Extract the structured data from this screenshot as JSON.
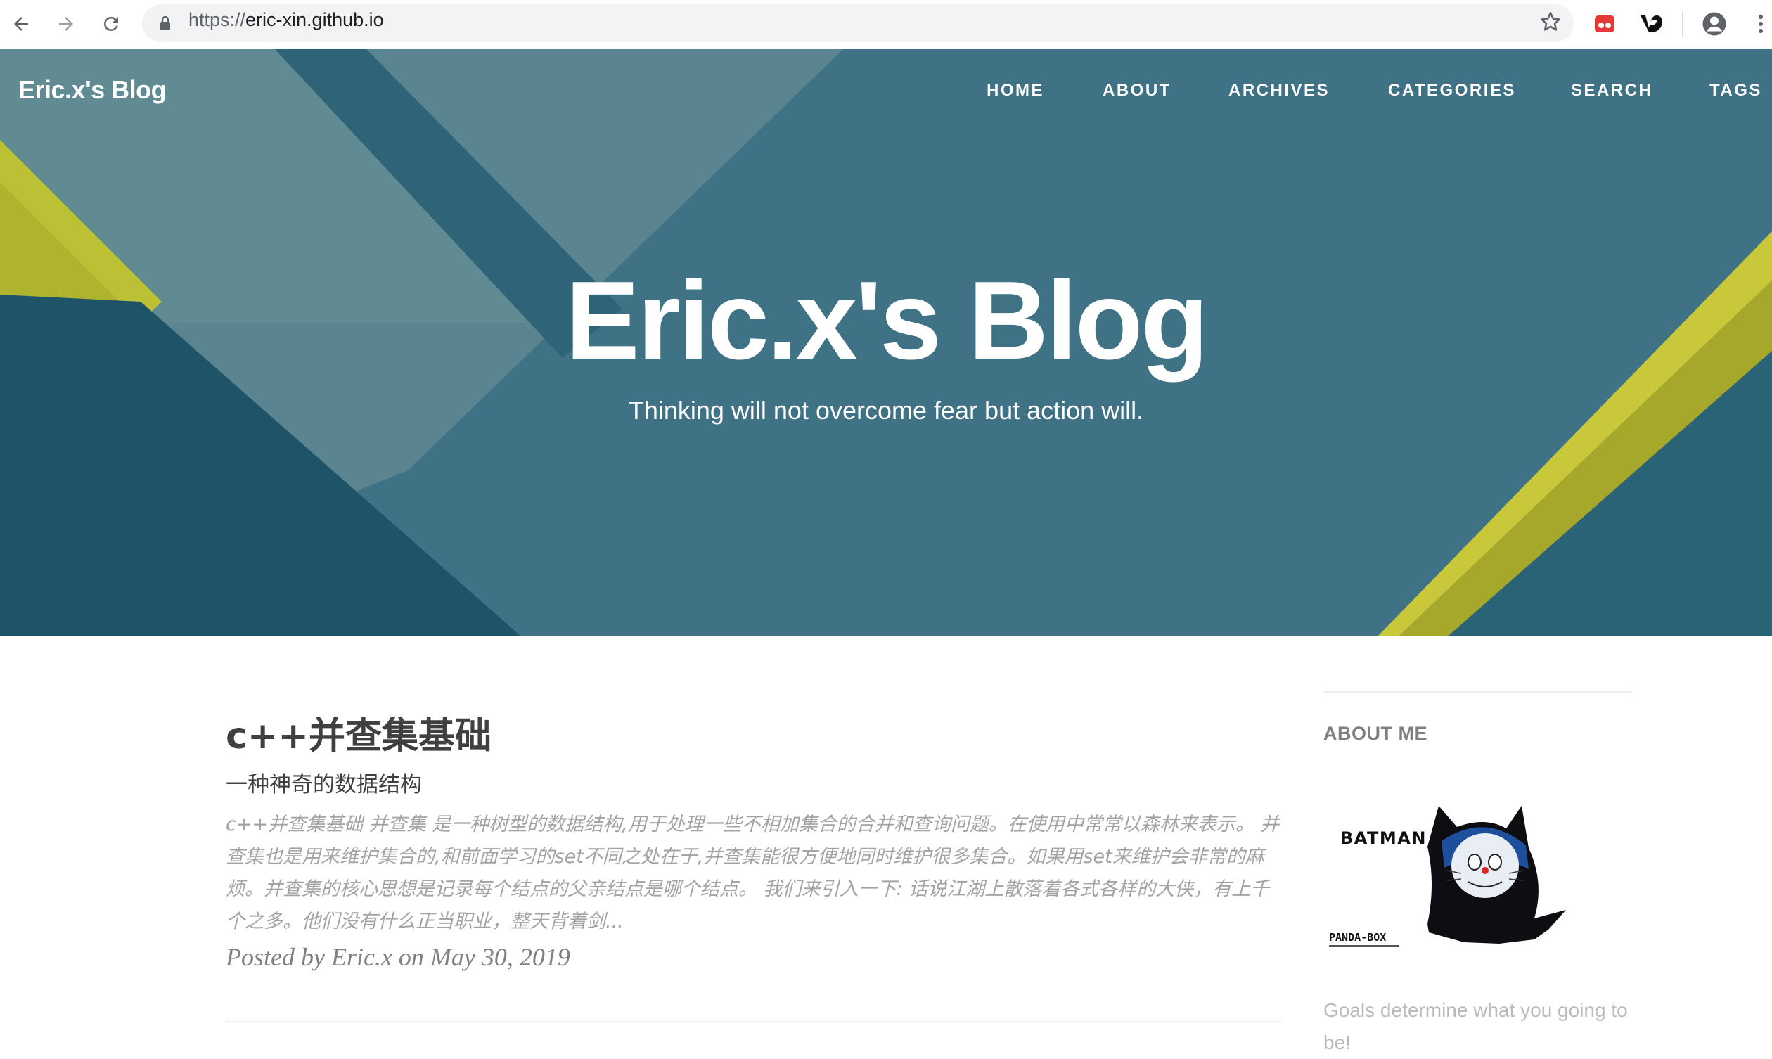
{
  "browser": {
    "url_scheme": "https://",
    "url_host": "eric-xin.github.io"
  },
  "site": {
    "brand": "Eric.x's Blog",
    "nav": [
      "HOME",
      "ABOUT",
      "ARCHIVES",
      "CATEGORIES",
      "SEARCH",
      "TAGS"
    ]
  },
  "hero": {
    "title": "Eric.x's Blog",
    "subtitle": "Thinking will not overcome fear but action will."
  },
  "post": {
    "title": "c++并查集基础",
    "subtitle": "一种神奇的数据结构",
    "excerpt": "c++并查集基础 并查集 是一种树型的数据结构,用于处理一些不相加集合的合并和查询问题。在使用中常常以森林来表示。 并查集也是用来维护集合的,和前面学习的set不同之处在于,并查集能很方便地同时维护很多集合。如果用set来维护会非常的麻烦。并查集的核心思想是记录每个结点的父亲结点是哪个结点。 我们来引入一下: 话说江湖上散落着各式各样的大侠，有上千个之多。他们没有什么正当职业，整天背着剑...",
    "meta": "Posted by Eric.x on May 30, 2019"
  },
  "sidebar": {
    "heading": "ABOUT ME",
    "avatar_text": "BATMAN",
    "avatar_brand": "PANDA-BOX",
    "bio": "Goals determine what you going to be!"
  },
  "colors": {
    "hero_teal": "#3f7285",
    "hero_dark": "#1e5266",
    "accent_yellow": "#bcc035",
    "text_dark": "#404040",
    "text_muted": "#a3a3a3"
  }
}
